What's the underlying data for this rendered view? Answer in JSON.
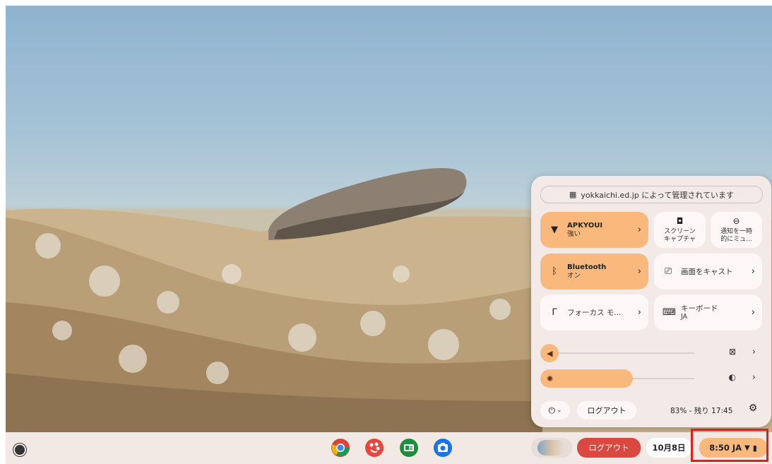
{
  "quick_settings": {
    "managed_by": "yokkaichi.ed.jp によって管理されています",
    "wifi": {
      "title": "APKYOUI",
      "subtitle": "強い"
    },
    "screen_capture": {
      "line1": "スクリーン",
      "line2": "キャプチャ"
    },
    "dnd": {
      "line1": "通知を一時",
      "line2": "的にミュ..."
    },
    "bluetooth": {
      "title": "Bluetooth",
      "subtitle": "オン"
    },
    "cast": {
      "label": "画面をキャスト"
    },
    "focus": {
      "label": "フォーカス モ..."
    },
    "keyboard": {
      "title": "キーボード",
      "subtitle": "JA"
    },
    "volume_level": 0.05,
    "brightness_level": 0.48,
    "logout_label": "ログアウト",
    "battery_text": "83% - 残り 17:45"
  },
  "shelf": {
    "apps": [
      "chrome-icon",
      "palette-icon",
      "classroom-icon",
      "camera-icon"
    ],
    "logout_label": "ログアウト",
    "date": "10月8日",
    "time": "8:50",
    "ime": "JA"
  },
  "colors": {
    "accent": "#f9b97d",
    "logout_button": "#d9493f",
    "highlight_box": "#e41d1d"
  }
}
